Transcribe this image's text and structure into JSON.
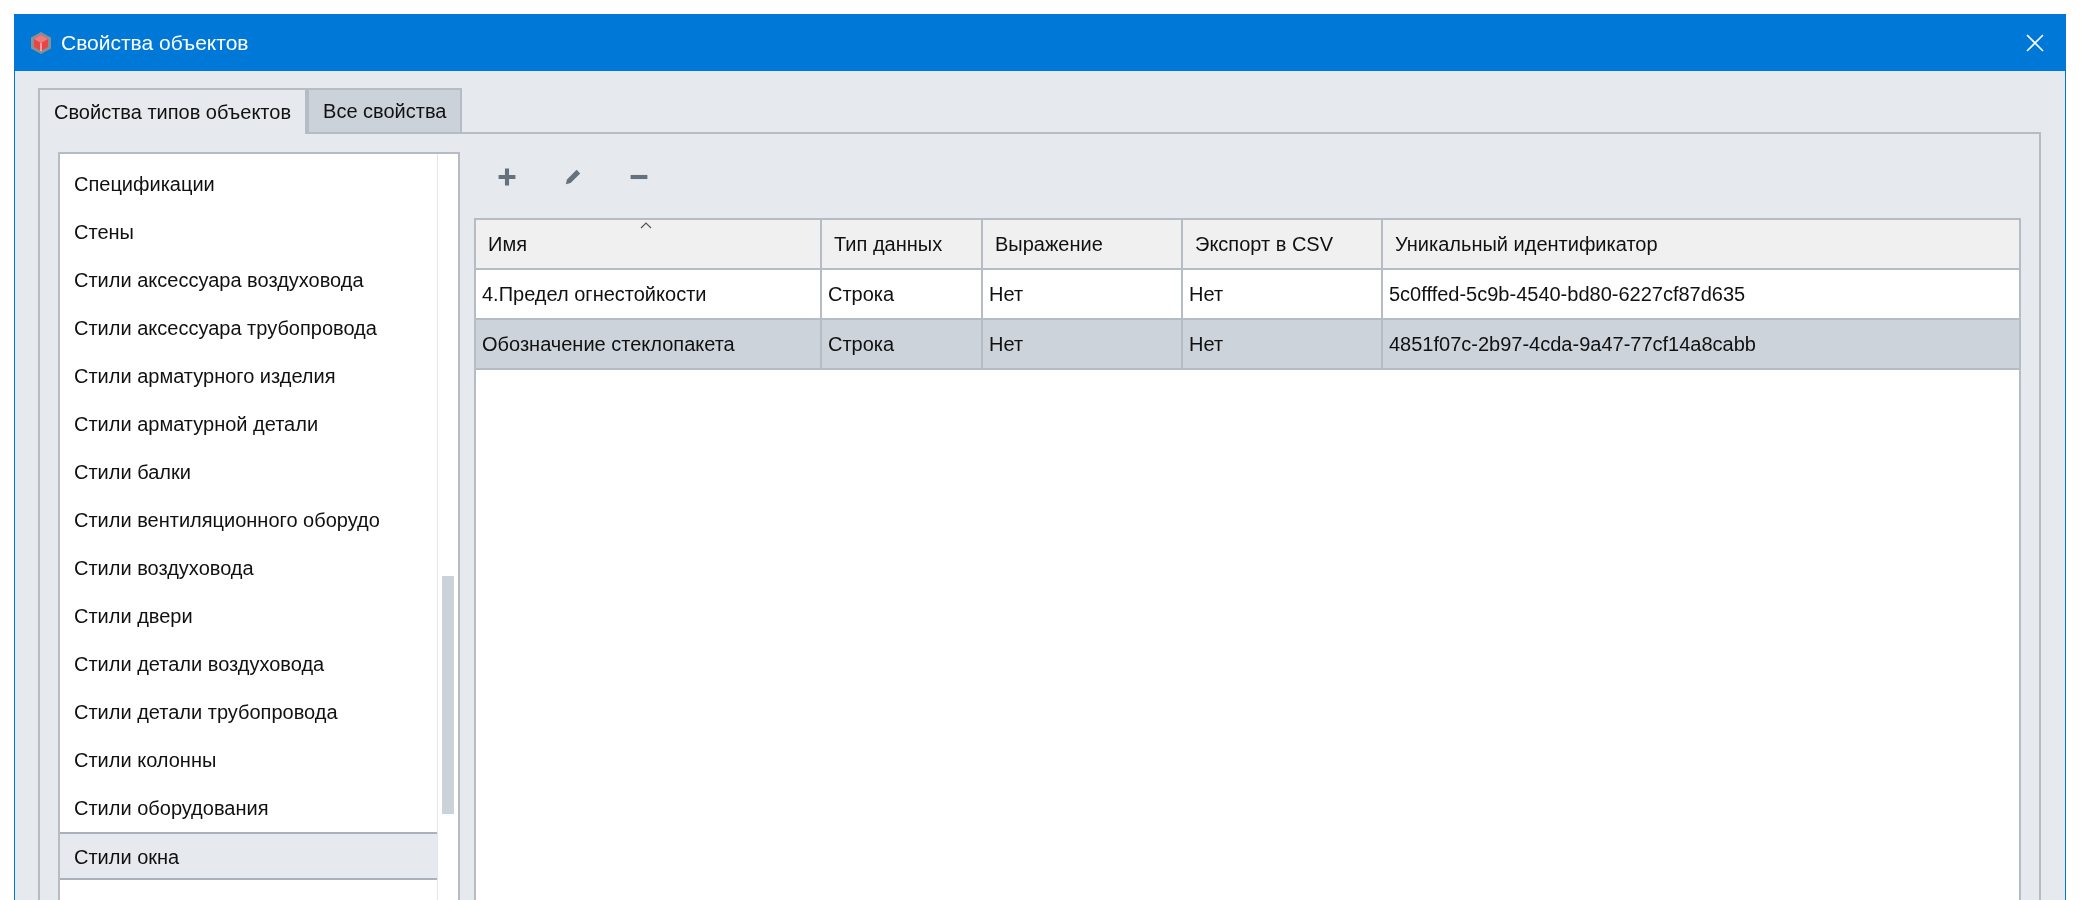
{
  "window": {
    "title": "Свойства объектов"
  },
  "tabs": [
    {
      "label": "Свойства типов объектов",
      "selected": true
    },
    {
      "label": "Все свойства",
      "selected": false
    }
  ],
  "object_types": [
    {
      "label": "Спецификации",
      "selected": false
    },
    {
      "label": "Стены",
      "selected": false
    },
    {
      "label": "Стили аксессуара воздуховода",
      "selected": false
    },
    {
      "label": "Стили аксессуара трубопровода",
      "selected": false
    },
    {
      "label": "Стили арматурного изделия",
      "selected": false
    },
    {
      "label": "Стили арматурной детали",
      "selected": false
    },
    {
      "label": "Стили балки",
      "selected": false
    },
    {
      "label": "Стили вентиляционного оборудо",
      "selected": false
    },
    {
      "label": "Стили воздуховода",
      "selected": false
    },
    {
      "label": "Стили двери",
      "selected": false
    },
    {
      "label": "Стили детали воздуховода",
      "selected": false
    },
    {
      "label": "Стили детали трубопровода",
      "selected": false
    },
    {
      "label": "Стили колонны",
      "selected": false
    },
    {
      "label": "Стили оборудования",
      "selected": false
    },
    {
      "label": "Стили окна",
      "selected": true
    }
  ],
  "toolbar": [
    {
      "kind": "add"
    },
    {
      "kind": "edit"
    },
    {
      "kind": "remove"
    }
  ],
  "table": {
    "columns": [
      {
        "label": "Имя",
        "sorted": true
      },
      {
        "label": "Тип данных",
        "sorted": false
      },
      {
        "label": "Выражение",
        "sorted": false
      },
      {
        "label": "Экспорт в CSV",
        "sorted": false
      },
      {
        "label": "Уникальный идентификатор",
        "sorted": false
      }
    ],
    "rows": [
      {
        "cells": [
          "4.Предел огнестойкости",
          "Строка",
          "Нет",
          "Нет",
          "5c0fffed-5c9b-4540-bd80-6227cf87d635"
        ],
        "selected": false
      },
      {
        "cells": [
          "Обозначение стеклопакета",
          "Строка",
          "Нет",
          "Нет",
          "4851f07c-2b97-4cda-9a47-77cf14a8cabb"
        ],
        "selected": true
      }
    ]
  }
}
